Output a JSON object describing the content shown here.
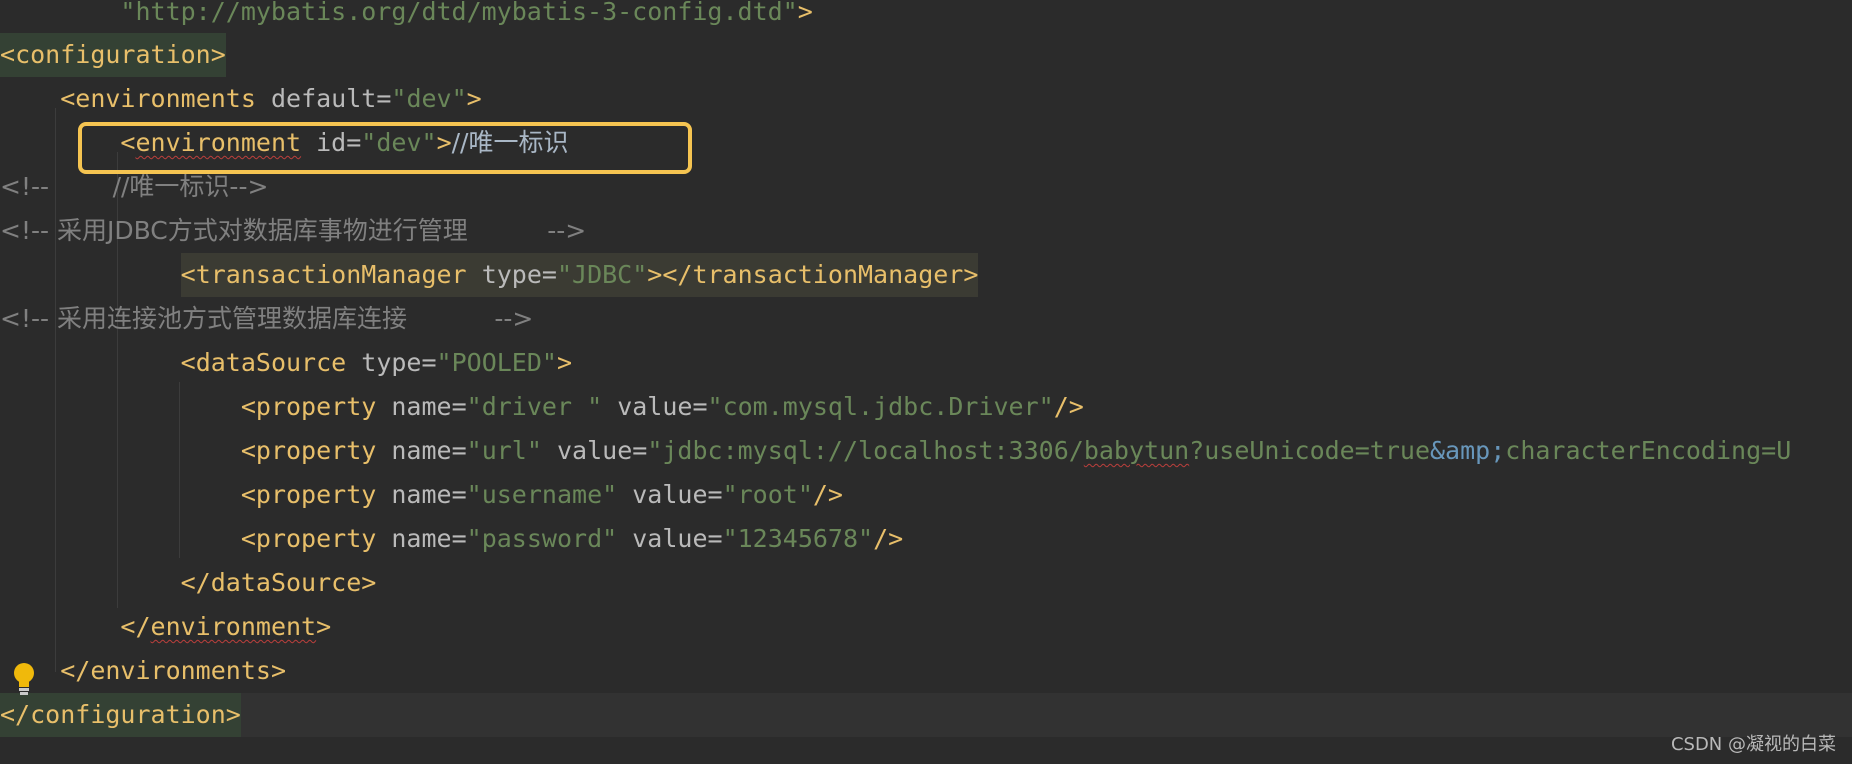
{
  "code_lines": {
    "l1": {
      "indent": "        ",
      "value": "\"http://mybatis.org/dtd/mybatis-3-config.dtd\"",
      "close": ">"
    },
    "l2": {
      "open": "<",
      "tag": "configuration",
      "close": ">"
    },
    "l3": {
      "indent": "    ",
      "open": "<",
      "tag": "environments",
      "attr": "default",
      "eq": "=",
      "value": "\"dev\"",
      "close": ">"
    },
    "l4": {
      "indent": "        ",
      "open": "<",
      "tag": "environment",
      "attr": "id",
      "eq": "=",
      "value": "\"dev\"",
      "close": ">",
      "trail": "//唯一标识"
    },
    "l5": {
      "text": "<!--        //唯一标识-->"
    },
    "l6": {
      "text": "<!-- 采用JDBC方式对数据库事物进行管理          -->"
    },
    "l7": {
      "indent": "            ",
      "open": "<",
      "tag": "transactionManager",
      "attr": "type",
      "eq": "=",
      "value": "\"JDBC\"",
      "close": "></",
      "tag2": "transactionManager",
      "close2": ">"
    },
    "l8": {
      "text": "<!-- 采用连接池方式管理数据库连接           -->"
    },
    "l9": {
      "indent": "            ",
      "open": "<",
      "tag": "dataSource",
      "attr": "type",
      "eq": "=",
      "value": "\"POOLED\"",
      "close": ">"
    },
    "l10": {
      "indent": "                ",
      "open": "<",
      "tag": "property",
      "attr1": "name",
      "eq": "=",
      "val1": "\"driver \"",
      "attr2": "value",
      "val2": "\"com.mysql.jdbc.Driver\"",
      "close": "/>"
    },
    "l11": {
      "indent": "                ",
      "open": "<",
      "tag": "property",
      "attr1": "name",
      "eq": "=",
      "val1": "\"url\"",
      "attr2": "value",
      "val2a": "\"jdbc:mysql://localhost:3306/",
      "squig": "babytun",
      "val2b": "?useUnicode=true",
      "entity": "&amp;",
      "val2c": "characterEncoding=U"
    },
    "l12": {
      "indent": "                ",
      "open": "<",
      "tag": "property",
      "attr1": "name",
      "eq": "=",
      "val1": "\"username\"",
      "attr2": "value",
      "val2": "\"root\"",
      "close": "/>"
    },
    "l13": {
      "indent": "                ",
      "open": "<",
      "tag": "property",
      "attr1": "name",
      "eq": "=",
      "val1": "\"password\"",
      "attr2": "value",
      "val2": "\"12345678\"",
      "close": "/>"
    },
    "l14": {
      "indent": "            ",
      "open": "</",
      "tag": "dataSource",
      "close": ">"
    },
    "l15": {
      "indent": "        ",
      "open": "</",
      "tag": "environment",
      "close": ">"
    },
    "l16": {
      "indent": "    ",
      "open": "</",
      "tag": "environments",
      "close": ">"
    },
    "l17": {
      "open": "</",
      "tag": "configuration",
      "close": ">"
    }
  },
  "icons": {
    "intention": "lightbulb-icon"
  },
  "watermark": "CSDN @凝视的白菜",
  "colors": {
    "callout": "#f5c451",
    "tag": "#e8bf6a",
    "string": "#6a8759",
    "comment": "#808080"
  }
}
